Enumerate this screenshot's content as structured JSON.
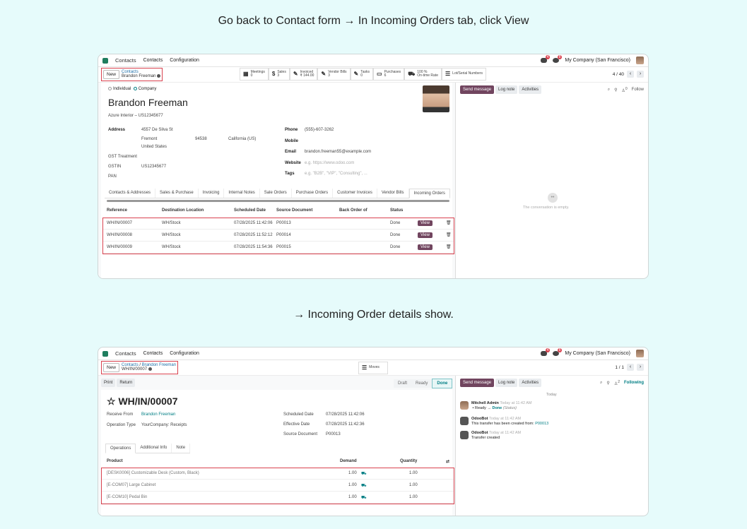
{
  "captions": {
    "first": "Go back to Contact form → In Incoming Orders tab, click View",
    "second": "→ Incoming Order details show."
  },
  "shot1": {
    "topbar": {
      "app": "Contacts",
      "menu1": "Contacts",
      "menu2": "Configuration",
      "badge1": "4",
      "badge2": "8",
      "company": "My Company (San Francisco)"
    },
    "control": {
      "new": "New",
      "crumb_parent": "Contacts",
      "crumb_current": "Brandon Freeman",
      "pager": "4 / 40"
    },
    "stats": [
      {
        "icon": "▦",
        "label": "Meetings",
        "value": "0"
      },
      {
        "icon": "$",
        "label": "Sales",
        "value": "3"
      },
      {
        "icon": "✎",
        "label": "Invoiced",
        "value": "₹ 144.00"
      },
      {
        "icon": "✎",
        "label": "Vendor Bills",
        "value": "3"
      },
      {
        "icon": "✎",
        "label": "Tasks",
        "value": "0"
      },
      {
        "icon": "▭",
        "label": "Purchases",
        "value": "6"
      },
      {
        "icon": "⛟",
        "label": "100 %",
        "value": "On-time Rate"
      },
      {
        "icon": "☰",
        "label": "Lot/Serial Numbers",
        "value": ""
      }
    ],
    "form": {
      "individual": "Individual",
      "company": "Company",
      "name": "Brandon Freeman",
      "company_line": "Azure Interior – US12345677",
      "address_label": "Address",
      "street": "4557 De Silva St",
      "city": "Fremont",
      "zip": "94538",
      "state": "California (US)",
      "country": "United States",
      "gst_label": "GST Treatment",
      "gstin_label": "GSTIN",
      "gstin_value": "US12345677",
      "pan_label": "PAN",
      "phone_label": "Phone",
      "phone_value": "(555)-607-3262",
      "mobile_label": "Mobile",
      "email_label": "Email",
      "email_value": "brandon.freeman55@example.com",
      "website_label": "Website",
      "website_ph": "e.g. https://www.odoo.com",
      "tags_label": "Tags",
      "tags_ph": "e.g. \"B2B\", \"VIP\", \"Consulting\", ..."
    },
    "tabs": [
      "Contacts & Addresses",
      "Sales & Purchase",
      "Invoicing",
      "Internal Notes",
      "Sale Orders",
      "Purchase Orders",
      "Customer Invoices",
      "Vendor Bills",
      "Incoming Orders"
    ],
    "table_headers": [
      "Reference",
      "Destination Location",
      "Scheduled Date",
      "Source Document",
      "Back Order of",
      "Status"
    ],
    "rows": [
      {
        "ref": "WH/IN/00007",
        "dest": "WH/Stock",
        "date": "07/28/2025 11:42:06",
        "src": "P00013",
        "status": "Done",
        "action": "View"
      },
      {
        "ref": "WH/IN/00008",
        "dest": "WH/Stock",
        "date": "07/28/2025 11:52:12",
        "src": "P00014",
        "status": "Done",
        "action": "View"
      },
      {
        "ref": "WH/IN/00009",
        "dest": "WH/Stock",
        "date": "07/28/2025 11:54:36",
        "src": "P00015",
        "status": "Done",
        "action": "View"
      }
    ],
    "chatter": {
      "send": "Send message",
      "log": "Log note",
      "activities": "Activities",
      "follow": "Follow",
      "attach_count": "0",
      "empty": "The conversation is empty."
    }
  },
  "shot2": {
    "topbar": {
      "app": "Contacts",
      "menu1": "Contacts",
      "menu2": "Configuration",
      "badge1": "4",
      "badge2": "8",
      "company": "My Company (San Francisco)"
    },
    "control": {
      "new": "New",
      "crumb_parent": "Contacts",
      "crumb_sep": "/",
      "crumb_mid": "Brandon Freeman",
      "crumb_current": "WH/IN/00007",
      "moves": "Moves",
      "pager": "1 / 1"
    },
    "actions": {
      "print": "Print",
      "return": "Return"
    },
    "status": [
      "Draft",
      "Ready",
      "Done"
    ],
    "form": {
      "title": "WH/IN/00007",
      "receive_from_label": "Receive From",
      "receive_from_value": "Brandon Freeman",
      "op_type_label": "Operation Type",
      "op_type_value": "YourCompany: Receipts",
      "sched_label": "Scheduled Date",
      "sched_value": "07/28/2025 11:42:06",
      "eff_label": "Effective Date",
      "eff_value": "07/28/2025 11:42:36",
      "srcdoc_label": "Source Document",
      "srcdoc_value": "P00013"
    },
    "tabs": [
      "Operations",
      "Additional Info",
      "Note"
    ],
    "table_headers": {
      "product": "Product",
      "demand": "Demand",
      "quantity": "Quantity"
    },
    "rows": [
      {
        "product": "[DESK0006] Customizable Desk (Custom, Black)",
        "demand": "1.00",
        "qty": "1.00"
      },
      {
        "product": "[E-COM07] Large Cabinet",
        "demand": "1.00",
        "qty": "1.00"
      },
      {
        "product": "[E-COM10] Pedal Bin",
        "demand": "1.00",
        "qty": "1.00"
      }
    ],
    "chatter": {
      "send": "Send message",
      "log": "Log note",
      "activities": "Activities",
      "following": "Following",
      "attach_count": "2",
      "today": "Today",
      "m1_author": "Mitchell Admin",
      "m1_time": "Today at 11:42 AM",
      "m1_bullet": "•",
      "m1_from": "Ready",
      "m1_arrow": "→",
      "m1_to": "Done",
      "m1_field": "(Status)",
      "m2_author": "OdooBot",
      "m2_time": "Today at 11:42 AM",
      "m2_text": "This transfer has been created from:",
      "m2_link": "P00013",
      "m3_author": "OdooBot",
      "m3_time": "Today at 11:42 AM",
      "m3_text": "Transfer created"
    }
  }
}
